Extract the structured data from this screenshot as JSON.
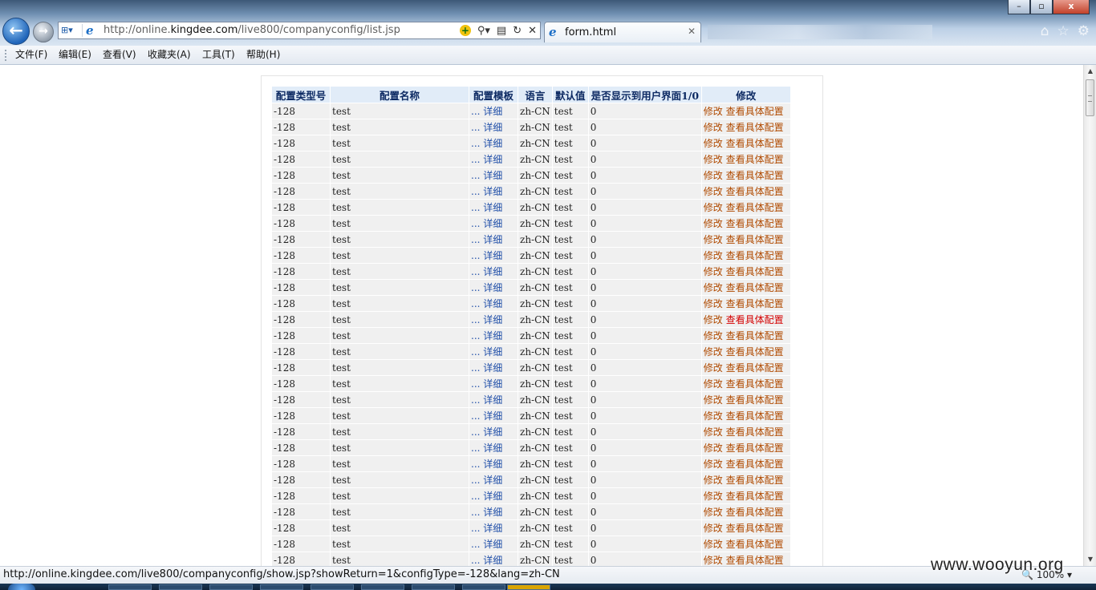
{
  "window": {
    "buttons": {
      "minimize": "–",
      "maximize": "▫",
      "close": "x"
    }
  },
  "addressbar": {
    "url_prefix": "http://online.",
    "url_domain": "kingdee.com",
    "url_path": "/live800/companyconfig/list.jsp"
  },
  "tabs": [
    {
      "label": "form.html"
    }
  ],
  "menu": [
    {
      "label": "文件(F)"
    },
    {
      "label": "编辑(E)"
    },
    {
      "label": "查看(V)"
    },
    {
      "label": "收藏夹(A)"
    },
    {
      "label": "工具(T)"
    },
    {
      "label": "帮助(H)"
    }
  ],
  "table": {
    "headers": [
      "配置类型号",
      "配置名称",
      "配置模板",
      "语言",
      "默认值",
      "是否显示到用户界面1/0",
      "修改"
    ],
    "row_values": {
      "type": "-128",
      "name": "test",
      "dots": "...",
      "detail": "详细",
      "lang": "zh-CN",
      "default": "test",
      "show": "0",
      "edit": "修改",
      "view": "查看具体配置"
    },
    "row_count": 29,
    "highlighted_row": 13
  },
  "statusbar": {
    "text": "http://online.kingdee.com/live800/companyconfig/show.jsp?showReturn=1&configType=-128&lang=zh-CN",
    "zoom": "100%"
  },
  "watermark": "www.wooyun.org",
  "colors": {
    "header_bg": "#e1ecf8",
    "header_text": "#0d2a63",
    "row_bg": "#f0f0f0",
    "link_blue": "#1f4ea8",
    "link_orange": "#b04a00",
    "link_red": "#d40000"
  }
}
